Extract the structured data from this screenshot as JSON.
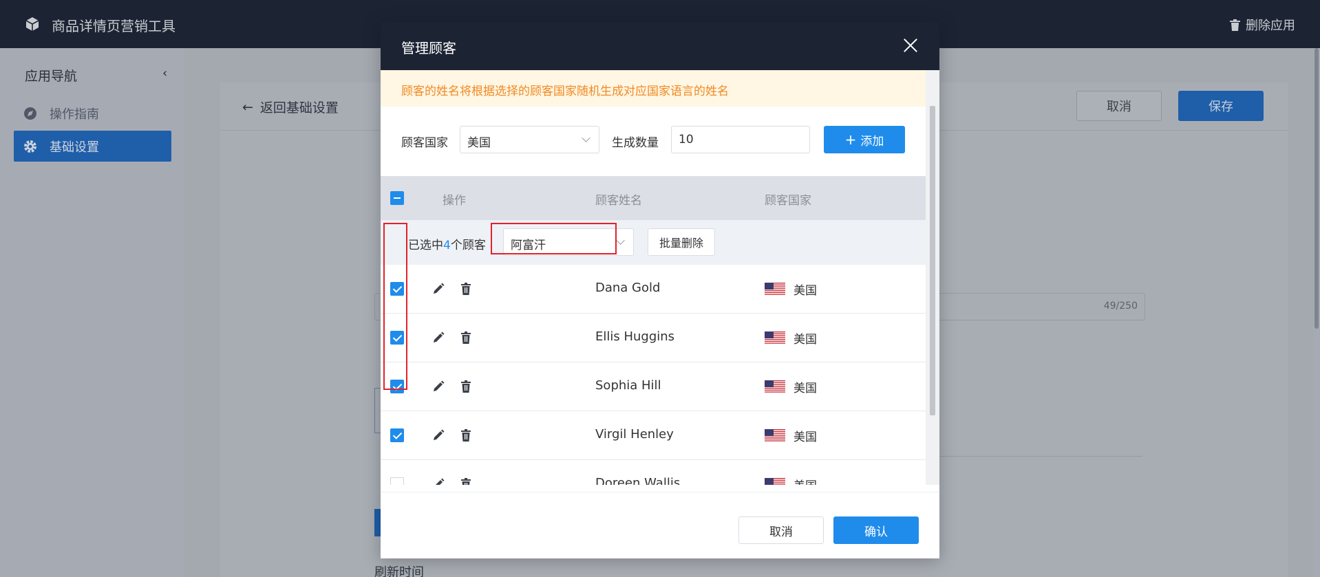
{
  "app": {
    "title": "商品详情页营销工具",
    "delete_app_label": "删除应用",
    "logo_icon": "box-icon",
    "delete_icon": "trash-icon"
  },
  "sidebar": {
    "title": "应用导航",
    "items": [
      {
        "label": "操作指南",
        "icon": "compass-icon",
        "active": false
      },
      {
        "label": "基础设置",
        "icon": "gear-icon",
        "active": true
      }
    ]
  },
  "page": {
    "back_label": "返回基础设置",
    "cancel_label": "取消",
    "save_label": "保存",
    "counter": "49/250",
    "refresh_label": "刷新时间"
  },
  "modal": {
    "title": "管理顾客",
    "notice": "顾客的姓名将根据选择的顾客国家随机生成对应国家语言的姓名",
    "country_label": "顾客国家",
    "country_value": "美国",
    "quantity_label": "生成数量",
    "quantity_value": "10",
    "add_label": "添加",
    "columns": {
      "action": "操作",
      "name": "顾客姓名",
      "country": "顾客国家"
    },
    "batch": {
      "prefix": "已选中",
      "count": "4",
      "suffix": "个顾客",
      "country_value": "阿富汗",
      "delete_label": "批量删除"
    },
    "rows": [
      {
        "name": "Dana Gold",
        "country": "美国",
        "checked": true
      },
      {
        "name": "Ellis Huggins",
        "country": "美国",
        "checked": true
      },
      {
        "name": "Sophia Hill",
        "country": "美国",
        "checked": true
      },
      {
        "name": "Virgil Henley",
        "country": "美国",
        "checked": true
      },
      {
        "name": "Doreen Wallis",
        "country": "美国",
        "checked": false
      }
    ],
    "cancel_label": "取消",
    "confirm_label": "确认"
  },
  "colors": {
    "primary": "#1f8ceb",
    "header_dark": "#1c2434",
    "notice_text": "#f08a24",
    "notice_bg": "#fff6e3",
    "highlight": "#e0222a"
  }
}
